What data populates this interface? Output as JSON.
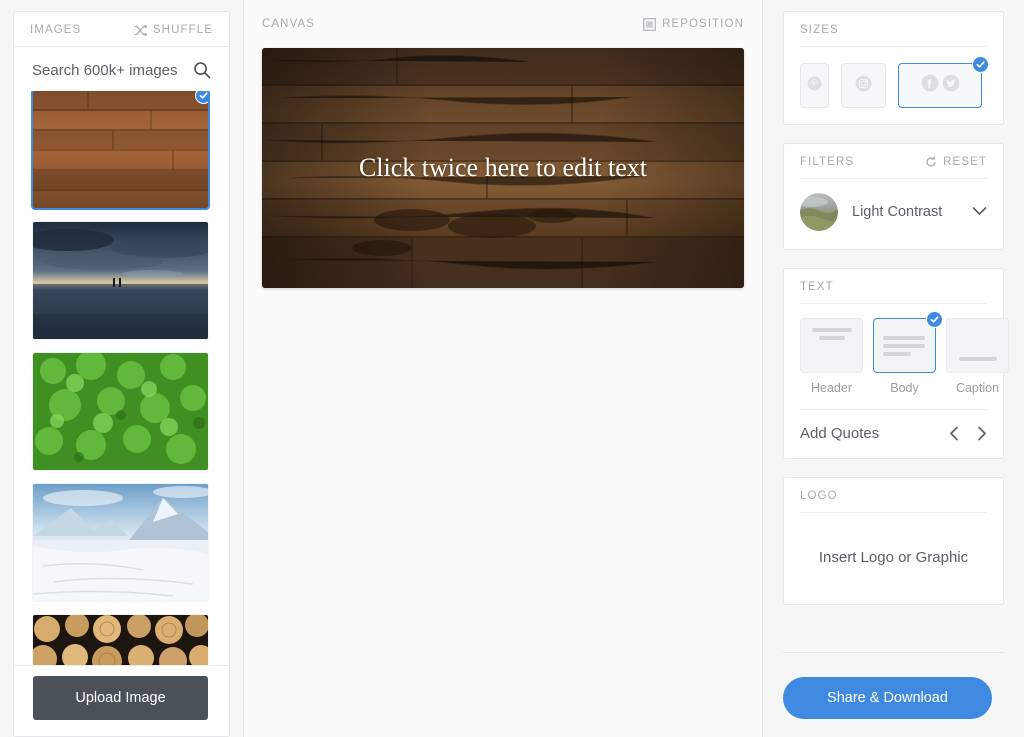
{
  "images_panel": {
    "title": "IMAGES",
    "shuffle_label": "SHUFFLE",
    "shuffle_icon": "shuffle-icon",
    "search_placeholder": "Search 600k+ images",
    "search_value": "",
    "search_icon": "search-icon",
    "thumbnails": [
      {
        "name": "wood-planks",
        "selected": true
      },
      {
        "name": "beach-sunset",
        "selected": false
      },
      {
        "name": "green-clover-leaves",
        "selected": false
      },
      {
        "name": "snow-mountain",
        "selected": false
      },
      {
        "name": "stacked-logs",
        "selected": false
      }
    ],
    "upload_label": "Upload Image"
  },
  "canvas": {
    "title": "CANVAS",
    "reposition_label": "REPOSITION",
    "reposition_icon": "reposition-icon",
    "text": "Click twice here to edit text",
    "background_image": "wood-planks"
  },
  "sizes": {
    "title": "SIZES",
    "options": [
      {
        "name": "pinterest",
        "icon": "pinterest-icon",
        "selected": false
      },
      {
        "name": "instagram",
        "icon": "instagram-icon",
        "selected": false
      },
      {
        "name": "facebook-twitter",
        "icon": "facebook-icon,twitter-icon",
        "selected": true
      }
    ]
  },
  "filters": {
    "title": "FILTERS",
    "reset_label": "RESET",
    "reset_icon": "reset-icon",
    "selected_filter": "Light Contrast",
    "chevron_icon": "chevron-down-icon"
  },
  "text_panel": {
    "title": "TEXT",
    "options": [
      {
        "label": "Header",
        "selected": false
      },
      {
        "label": "Body",
        "selected": true
      },
      {
        "label": "Caption",
        "selected": false
      }
    ],
    "quotes_label": "Add Quotes",
    "prev_icon": "chevron-left-icon",
    "next_icon": "chevron-right-icon"
  },
  "logo": {
    "title": "LOGO",
    "placeholder": "Insert Logo or Graphic"
  },
  "share": {
    "label": "Share & Download"
  },
  "colors": {
    "accent": "#3f8ae0",
    "upload_button": "#4a5159",
    "panel_border": "#e6e7e9",
    "muted_text": "#a7aaae",
    "body_text": "#5a6068"
  }
}
